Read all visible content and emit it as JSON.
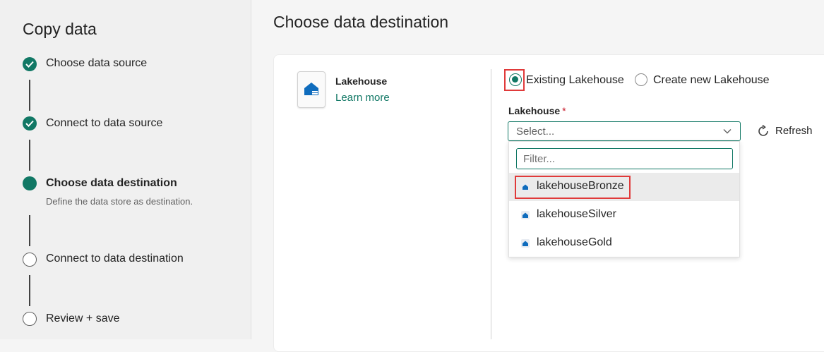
{
  "wizard": {
    "title": "Copy data",
    "steps": [
      {
        "label": "Choose data source",
        "state": "done"
      },
      {
        "label": "Connect to data source",
        "state": "done"
      },
      {
        "label": "Choose data destination",
        "state": "current",
        "description": "Define the data store as destination."
      },
      {
        "label": "Connect to data destination",
        "state": "todo"
      },
      {
        "label": "Review + save",
        "state": "todo"
      }
    ]
  },
  "main": {
    "title": "Choose data destination",
    "destination": {
      "icon": "lakehouse-icon",
      "name": "Lakehouse",
      "learn_more": "Learn more"
    },
    "mode": {
      "options": [
        "Existing Lakehouse",
        "Create new Lakehouse"
      ],
      "selected": "Existing Lakehouse"
    },
    "lakehouse_field": {
      "label": "Lakehouse",
      "required_mark": "*",
      "placeholder": "Select...",
      "refresh_label": "Refresh",
      "filter_placeholder": "Filter...",
      "options": [
        "lakehouseBronze",
        "lakehouseSilver",
        "lakehouseGold"
      ],
      "highlighted_option": "lakehouseBronze"
    }
  },
  "colors": {
    "accent": "#117865",
    "highlight_outline": "#e03a3a",
    "required": "#c50f1f"
  }
}
